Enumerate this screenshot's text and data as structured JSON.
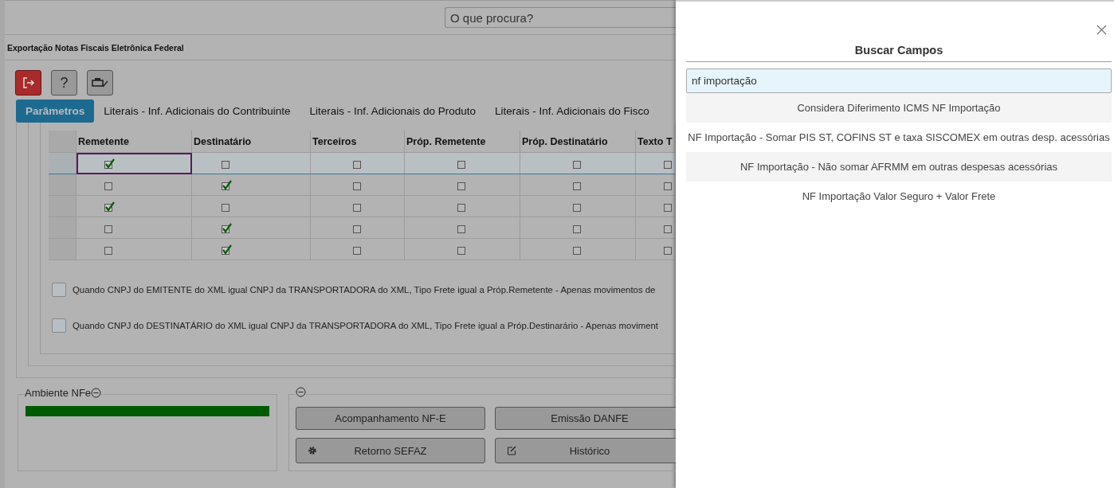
{
  "search": {
    "placeholder": "O que procura?"
  },
  "title": "Exportação Notas Fiscais Eletrônica Federal",
  "toolbar": [
    {
      "kind": "exit"
    },
    {
      "kind": "help",
      "label": "?"
    },
    {
      "kind": "print"
    }
  ],
  "tabs": [
    {
      "label": "Parâmetros",
      "selected": true
    },
    {
      "label": "Literais - Inf. Adicionais do Contribuinte",
      "selected": false
    },
    {
      "label": "Literais - Inf. Adicionais do Produto",
      "selected": false
    },
    {
      "label": "Literais - Inf. Adicionais do Fisco",
      "selected": false
    }
  ],
  "table": {
    "columns": [
      "Remetente",
      "Destinatário",
      "Terceiros",
      "Próp. Remetente",
      "Próp. Destinatário",
      "Texto T"
    ],
    "rows": [
      {
        "selected": true,
        "checks": [
          true,
          false,
          false,
          false,
          false,
          false
        ]
      },
      {
        "selected": false,
        "checks": [
          false,
          true,
          false,
          false,
          false,
          false
        ]
      },
      {
        "selected": false,
        "checks": [
          true,
          false,
          false,
          false,
          false,
          false
        ]
      },
      {
        "selected": false,
        "checks": [
          false,
          true,
          false,
          false,
          false,
          false
        ]
      },
      {
        "selected": false,
        "checks": [
          false,
          true,
          false,
          false,
          false,
          false
        ]
      }
    ]
  },
  "options": [
    {
      "label": "Quando CNPJ do EMITENTE do XML igual CNPJ da TRANSPORTADORA do XML, Tipo Frete igual a Próp.Remetente - Apenas movimentos de",
      "checked": false
    },
    {
      "label": "Quando CNPJ do DESTINATÁRIO do XML igual CNPJ da TRANSPORTADORA do XML, Tipo Frete igual a Próp.Destinarário - Apenas moviment",
      "checked": false
    }
  ],
  "ambiente": {
    "label": "Ambiente NFe",
    "level": 1
  },
  "actions": [
    {
      "label": "Acompanhamento NF-E",
      "kind": "plain"
    },
    {
      "label": "Emissão DANFE",
      "kind": "plain"
    },
    {
      "label": "Retorno SEFAZ",
      "kind": "gear"
    },
    {
      "label": "Histórico",
      "kind": "edit"
    }
  ],
  "panel": {
    "title": "Buscar Campos",
    "query": "nf importação",
    "results": [
      "Considera Diferimento ICMS NF Importação",
      "NF Importação - Somar PIS ST, COFINS ST e taxa SISCOMEX em outras desp. acessórias",
      "NF Importação - Não somar AFRMM em outras despesas acessórias",
      "NF Importação Valor Seguro + Valor Frete"
    ]
  }
}
